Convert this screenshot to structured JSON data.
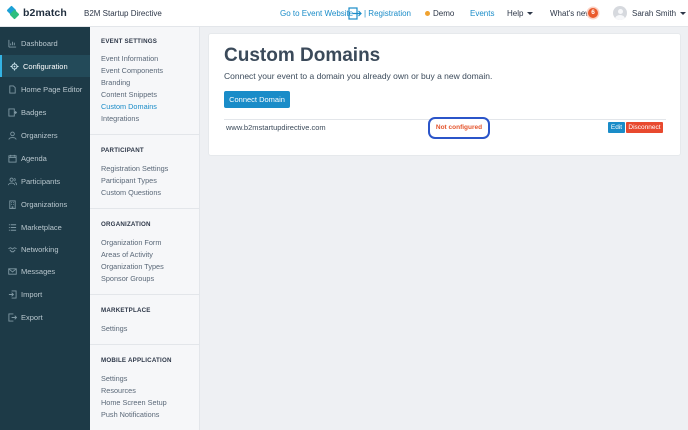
{
  "header": {
    "logo_text": "b2match",
    "event_name": "B2M Startup Directive",
    "go_to_website": "Go to Event Website",
    "registration": "| Registration",
    "demo": "Demo",
    "events": "Events",
    "help": "Help",
    "whats_new": "What's new",
    "whats_new_count": "6",
    "user_name": "Sarah Smith",
    "accent_color": "#1a8cc8"
  },
  "sidebar": {
    "items": [
      {
        "label": "Dashboard",
        "icon": "chart-icon"
      },
      {
        "label": "Configuration",
        "icon": "gear-icon",
        "active": true
      },
      {
        "label": "Home Page Editor",
        "icon": "document-icon"
      },
      {
        "label": "Badges",
        "icon": "badge-icon"
      },
      {
        "label": "Organizers",
        "icon": "person-icon"
      },
      {
        "label": "Agenda",
        "icon": "calendar-icon"
      },
      {
        "label": "Participants",
        "icon": "people-icon"
      },
      {
        "label": "Organizations",
        "icon": "building-icon"
      },
      {
        "label": "Marketplace",
        "icon": "list-icon"
      },
      {
        "label": "Networking",
        "icon": "handshake-icon"
      },
      {
        "label": "Messages",
        "icon": "envelope-icon"
      },
      {
        "label": "Import",
        "icon": "import-icon"
      },
      {
        "label": "Export",
        "icon": "export-icon"
      }
    ]
  },
  "subnav": {
    "sections": [
      {
        "title": "EVENT SETTINGS",
        "items": [
          "Event Information",
          "Event Components",
          "Branding",
          "Content Snippets",
          "Custom Domains",
          "Integrations"
        ]
      },
      {
        "title": "PARTICIPANT",
        "items": [
          "Registration Settings",
          "Participant Types",
          "Custom Questions"
        ]
      },
      {
        "title": "ORGANIZATION",
        "items": [
          "Organization Form",
          "Areas of Activity",
          "Organization Types",
          "Sponsor Groups"
        ]
      },
      {
        "title": "MARKETPLACE",
        "items": [
          "Settings"
        ]
      },
      {
        "title": "MOBILE APPLICATION",
        "items": [
          "Settings",
          "Resources",
          "Home Screen Setup",
          "Push Notifications"
        ]
      }
    ],
    "active_item": "Custom Domains"
  },
  "main": {
    "title": "Custom Domains",
    "subtitle": "Connect your event to a domain you already own or buy a new domain.",
    "connect_button": "Connect Domain",
    "domains": [
      {
        "domain": "www.b2mstartupdirective.com",
        "status": "Not configured",
        "edit": "Edit",
        "disconnect": "Disconnect"
      }
    ]
  }
}
